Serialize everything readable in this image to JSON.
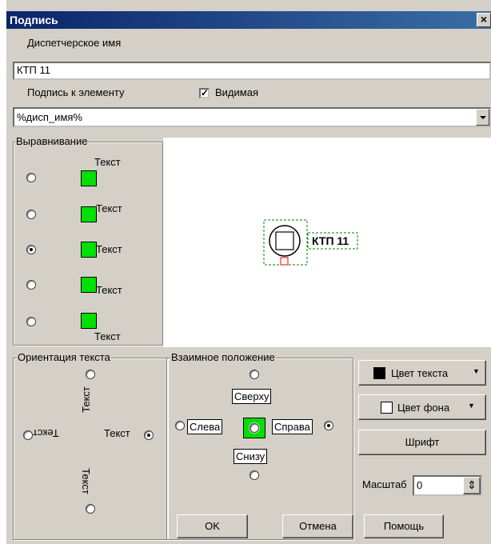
{
  "window": {
    "title": "Подпись",
    "close": "×"
  },
  "dispatcher": {
    "label": "Диспетчерское имя",
    "value": "КТП 11"
  },
  "caption": {
    "label": "Подпись к элементу",
    "visible_label": "Видимая",
    "visible_checked": true,
    "value": "%дисп_имя%"
  },
  "alignment": {
    "label": "Выравнивание",
    "options": [
      {
        "text": "Текст",
        "selected": false
      },
      {
        "text": "Текст",
        "selected": false
      },
      {
        "text": "Текст",
        "selected": true
      },
      {
        "text": "Текст",
        "selected": false
      },
      {
        "text": "Текст",
        "selected": false
      }
    ]
  },
  "preview": {
    "element_label": "КТП 11"
  },
  "orientation": {
    "label": "Ориентация текста",
    "up": "Текст",
    "left": "Текст",
    "right": "Текст",
    "down": "Текст",
    "selected": "right"
  },
  "position": {
    "label": "Взаимное положение",
    "top": "Сверху",
    "left": "Слева",
    "right": "Справа",
    "bottom": "Снизу",
    "selected": "right"
  },
  "buttons": {
    "text_color": "Цвет текста",
    "bg_color": "Цвет фона",
    "font": "Шрифт",
    "ok": "OK",
    "cancel": "Отмена",
    "help": "Помощь"
  },
  "scale": {
    "label": "Масштаб",
    "value": "0"
  },
  "colors": {
    "text_color_swatch": "#000000",
    "bg_color_swatch": "#ffffff",
    "green": "#00e000",
    "title_bar": "#0a246a"
  }
}
